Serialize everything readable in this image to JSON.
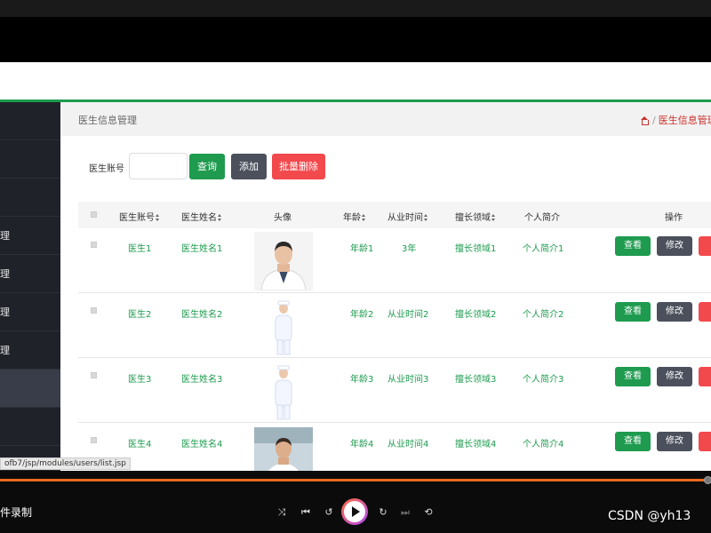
{
  "crumb": {
    "title": "医生信息管理",
    "current": "医生信息管理",
    "sep": "/"
  },
  "sidebar": {
    "items": [
      "",
      "",
      "",
      "理",
      "理",
      "理",
      "理",
      "",
      "",
      ""
    ]
  },
  "search": {
    "label": "医生账号",
    "value": ""
  },
  "toolbar": {
    "query_label": "查询",
    "add_label": "添加",
    "batch_delete_label": "批量删除"
  },
  "table": {
    "headers": {
      "account": "医生账号",
      "name": "医生姓名",
      "avatar": "头像",
      "age": "年龄",
      "years": "从业时间",
      "specialty": "擅长领域",
      "bio": "个人简介",
      "ops": "操作"
    },
    "rows": [
      {
        "account": "医生1",
        "name": "医生姓名1",
        "age": "年龄1",
        "years": "3年",
        "specialty": "擅长领域1",
        "bio": "个人简介1"
      },
      {
        "account": "医生2",
        "name": "医生姓名2",
        "age": "年龄2",
        "years": "从业时间2",
        "specialty": "擅长领域2",
        "bio": "个人简介2"
      },
      {
        "account": "医生3",
        "name": "医生姓名3",
        "age": "年龄3",
        "years": "从业时间3",
        "specialty": "擅长领域3",
        "bio": "个人简介3"
      },
      {
        "account": "医生4",
        "name": "医生姓名4",
        "age": "年龄4",
        "years": "从业时间4",
        "specialty": "擅长领域4",
        "bio": "个人简介4"
      }
    ],
    "row_actions": {
      "view": "查看",
      "edit": "修改"
    }
  },
  "status_url": "ofb7/jsp/modules/users/list.jsp",
  "player": {
    "label": "件录制"
  },
  "watermark": "CSDN @yh13",
  "colors": {
    "accent": "#1e9b4f",
    "danger": "#f2494d",
    "sidebar": "#20222a",
    "progress": "#e96a1e"
  }
}
